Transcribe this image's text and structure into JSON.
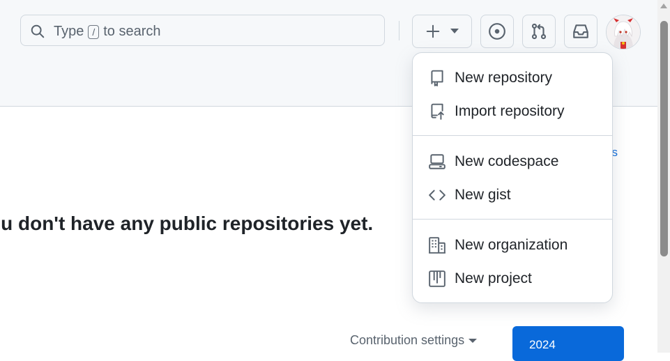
{
  "search": {
    "prefix": "Type",
    "key": "/",
    "suffix": "to search"
  },
  "header_buttons": {
    "create": "plus-icon",
    "issues": "issue-opened-icon",
    "pulls": "git-pull-request-icon",
    "inbox": "inbox-icon"
  },
  "main": {
    "empty_message": "ou don't have any public repositories yet.",
    "partial_link": "ns",
    "contribution_settings": "Contribution settings",
    "year": "2024"
  },
  "menu": {
    "items": [
      {
        "label": "New repository",
        "icon": "repo-icon"
      },
      {
        "label": "Import repository",
        "icon": "repo-push-icon"
      },
      {
        "label": "New codespace",
        "icon": "codespaces-icon"
      },
      {
        "label": "New gist",
        "icon": "code-icon"
      },
      {
        "label": "New organization",
        "icon": "organization-icon"
      },
      {
        "label": "New project",
        "icon": "project-icon"
      }
    ]
  },
  "colors": {
    "accent": "#0969da",
    "header_bg": "#f6f8fa",
    "border": "#d0d7de",
    "text": "#1f2328",
    "muted": "#59636e"
  }
}
